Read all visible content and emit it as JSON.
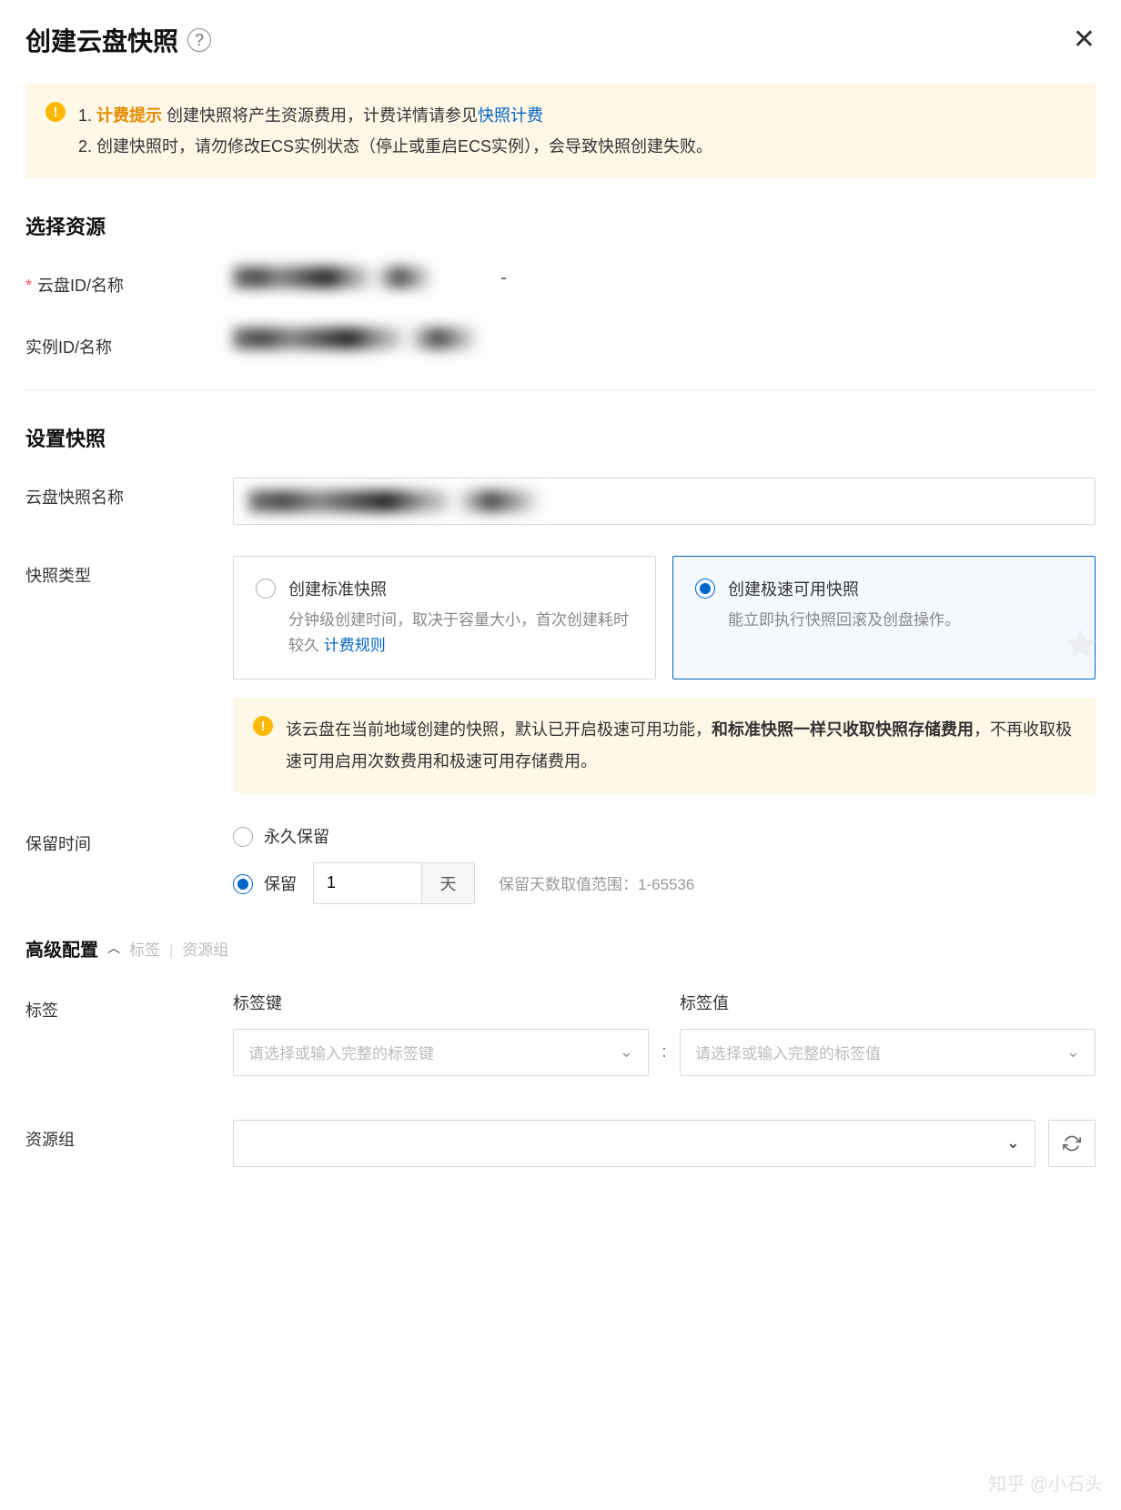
{
  "header": {
    "title": "创建云盘快照"
  },
  "alert1": {
    "line1_prefix": "1. ",
    "line1_orange": "计费提示",
    "line1_mid": " 创建快照将产生资源费用，计费详情请参见",
    "line1_link": "快照计费",
    "line2": "2. 创建快照时，请勿修改ECS实例状态（停止或重启ECS实例），会导致快照创建失败。"
  },
  "sections": {
    "resource_title": "选择资源",
    "snapshot_title": "设置快照"
  },
  "labels": {
    "disk_id": "云盘ID/名称",
    "instance_id": "实例ID/名称",
    "snapshot_name": "云盘快照名称",
    "snapshot_type": "快照类型",
    "retain_time": "保留时间",
    "tag": "标签",
    "tag_key": "标签键",
    "tag_value": "标签值",
    "resource_group": "资源组"
  },
  "type_options": {
    "standard": {
      "title": "创建标准快照",
      "desc_prefix": "分钟级创建时间，取决于容量大小，首次创建耗时较久 ",
      "desc_link": "计费规则"
    },
    "fast": {
      "title": "创建极速可用快照",
      "desc": "能立即执行快照回滚及创盘操作。"
    }
  },
  "alert2": {
    "prefix": "该云盘在当前地域创建的快照，默认已开启极速可用功能，",
    "bold": "和标准快照一样只收取快照存储费用",
    "suffix": "，不再收取极速可用启用次数费用和极速可用存储费用。"
  },
  "retain": {
    "permanent": "永久保留",
    "keep": "保留",
    "value": "1",
    "unit": "天",
    "hint": "保留天数取值范围：1-65536"
  },
  "advanced": {
    "title": "高级配置",
    "crumb1": "标签",
    "crumb2": "资源组"
  },
  "placeholders": {
    "tag_key": "请选择或输入完整的标签键",
    "tag_value": "请选择或输入完整的标签值"
  },
  "watermark": "知乎 @小石头"
}
